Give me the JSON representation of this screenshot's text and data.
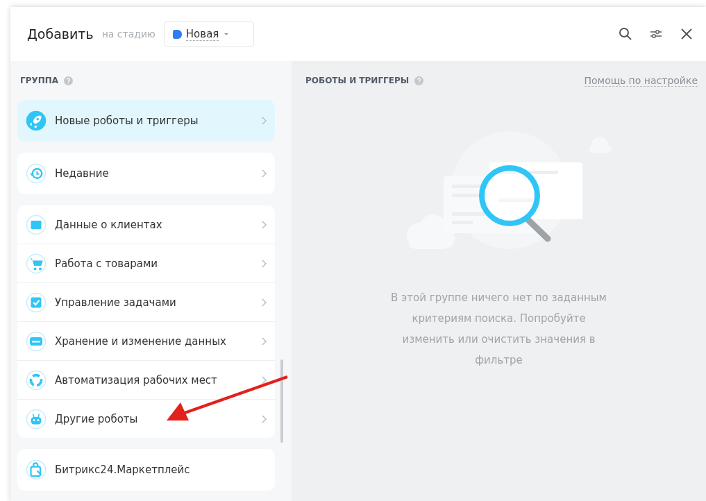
{
  "header": {
    "title": "Добавить",
    "stage_label": "на стадию",
    "stage": {
      "name": "Новая",
      "color": "#2f7cf6"
    }
  },
  "groups_panel": {
    "heading": "ГРУППА",
    "cards": [
      {
        "items": [
          {
            "label": "Новые роботы и триггеры",
            "selected": true
          }
        ]
      },
      {
        "items": [
          {
            "label": "Недавние",
            "selected": false
          }
        ]
      },
      {
        "items": [
          {
            "label": "Данные о клиентах",
            "selected": false
          },
          {
            "label": "Работа с товарами",
            "selected": false
          },
          {
            "label": "Управление задачами",
            "selected": false
          },
          {
            "label": "Хранение и изменение данных",
            "selected": false
          },
          {
            "label": "Автоматизация рабочих мест",
            "selected": false
          },
          {
            "label": "Другие роботы",
            "selected": false
          }
        ]
      },
      {
        "items": [
          {
            "label": "Битрикс24.Маркетплейс",
            "selected": false
          }
        ]
      }
    ]
  },
  "robots_panel": {
    "heading": "РОБОТЫ И ТРИГГЕРЫ",
    "help_link": "Помощь по настройке",
    "empty_message": "В этой группе ничего нет по заданным критериям поиска. Попробуйте изменить или очистить значения в фильтре"
  }
}
